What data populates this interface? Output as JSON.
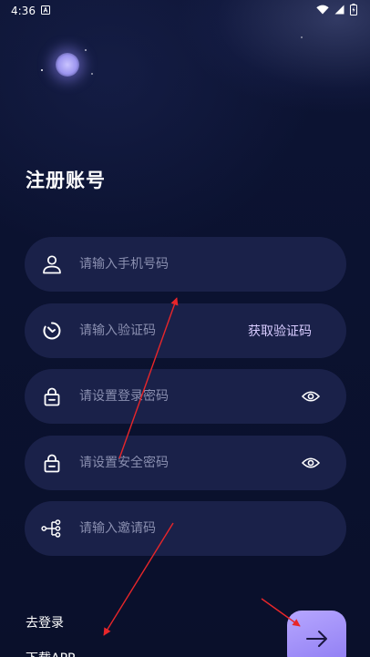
{
  "status_bar": {
    "time": "4:36",
    "icons": [
      "notification-a-icon",
      "wifi-icon",
      "signal-icon",
      "battery-charging-icon"
    ]
  },
  "page": {
    "title": "注册账号"
  },
  "form": {
    "phone": {
      "placeholder": "请输入手机号码",
      "value": "",
      "icon": "user-icon"
    },
    "code": {
      "placeholder": "请输入验证码",
      "value": "",
      "icon": "timer-icon",
      "action_label": "获取验证码"
    },
    "login_password": {
      "placeholder": "请设置登录密码",
      "value": "",
      "icon": "lock-icon",
      "toggle_icon": "eye-icon"
    },
    "security_password": {
      "placeholder": "请设置安全密码",
      "value": "",
      "icon": "lock-icon",
      "toggle_icon": "eye-icon"
    },
    "invite": {
      "placeholder": "请输入邀请码",
      "value": "",
      "icon": "share-nodes-icon"
    }
  },
  "links": {
    "login": "去登录",
    "download": "下载APP"
  },
  "submit": {
    "icon": "arrow-right-icon"
  },
  "colors": {
    "background": "#0b1230",
    "field_bg": "#1a2149",
    "placeholder": "#8a8fb0",
    "accent": "#a293f7",
    "annotation": "#e8262a"
  }
}
